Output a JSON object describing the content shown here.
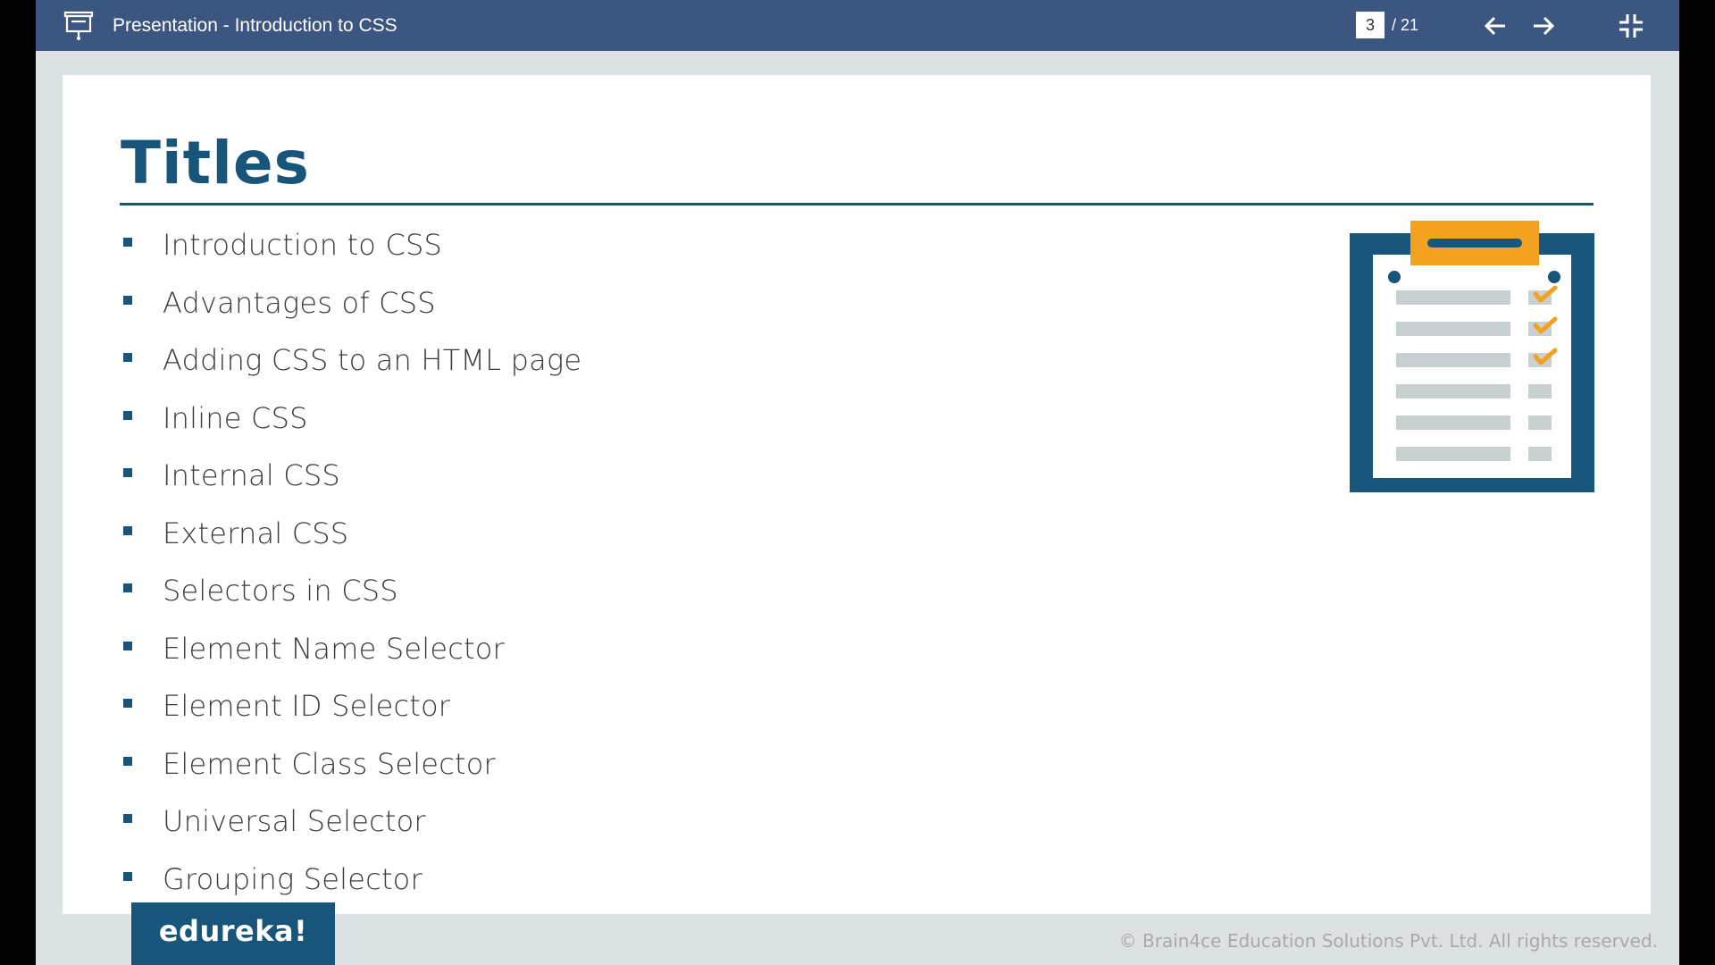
{
  "toolbar": {
    "icon": "presentation-icon",
    "title": "Presentation - Introduction to CSS",
    "page_current": "3",
    "page_total": "/ 21",
    "prev_icon": "arrow-left-icon",
    "next_icon": "arrow-right-icon",
    "exit_icon": "exit-fullscreen-icon",
    "background_color": "#3b5680"
  },
  "slide": {
    "title": "Titles",
    "accent_color": "#17557a",
    "highlight_color": "#f2a21e",
    "items": [
      "Introduction to CSS",
      "Advantages of CSS",
      "Adding CSS to an HTML page",
      "Inline CSS",
      "Internal CSS",
      "External CSS",
      "Selectors in CSS",
      "Element Name Selector",
      "Element ID Selector",
      "Element Class Selector",
      "Universal Selector",
      "Grouping Selector"
    ],
    "illustration": "clipboard-checklist-icon",
    "checklist_checked": 3,
    "checklist_total": 6
  },
  "footer": {
    "brand": "edureka!",
    "copyright": "© Brain4ce Education Solutions Pvt. Ltd. All rights reserved."
  }
}
